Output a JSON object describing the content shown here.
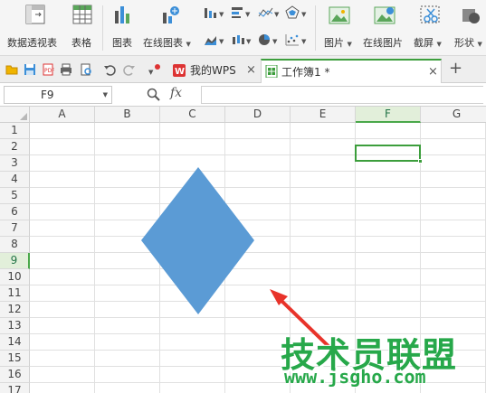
{
  "ribbon": {
    "pivot_table": "数据透视表",
    "table": "表格",
    "chart": "图表",
    "online_chart": "在线图表",
    "picture": "图片",
    "online_picture": "在线图片",
    "screenshot": "截屏",
    "shape": "形状"
  },
  "tabs": {
    "wps_label": "我的WPS",
    "workbook_label": "工作簿1 *",
    "close": "×",
    "new": "+"
  },
  "formula": {
    "cell_ref": "F9",
    "fx": "fx"
  },
  "columns": [
    "A",
    "B",
    "C",
    "D",
    "E",
    "F",
    "G"
  ],
  "rows": [
    "1",
    "2",
    "3",
    "4",
    "5",
    "6",
    "7",
    "8",
    "9",
    "10",
    "11",
    "12",
    "13",
    "14",
    "15",
    "16",
    "17"
  ],
  "selection": {
    "column": "F",
    "row": "9"
  },
  "shape": {
    "type": "diamond",
    "fill": "#5b9bd5"
  },
  "annotation": {
    "arrow_color": "#e8332a"
  },
  "watermark": {
    "title": "技术员联盟",
    "url": "www.jsgho.com",
    "color": "#27a84a"
  }
}
